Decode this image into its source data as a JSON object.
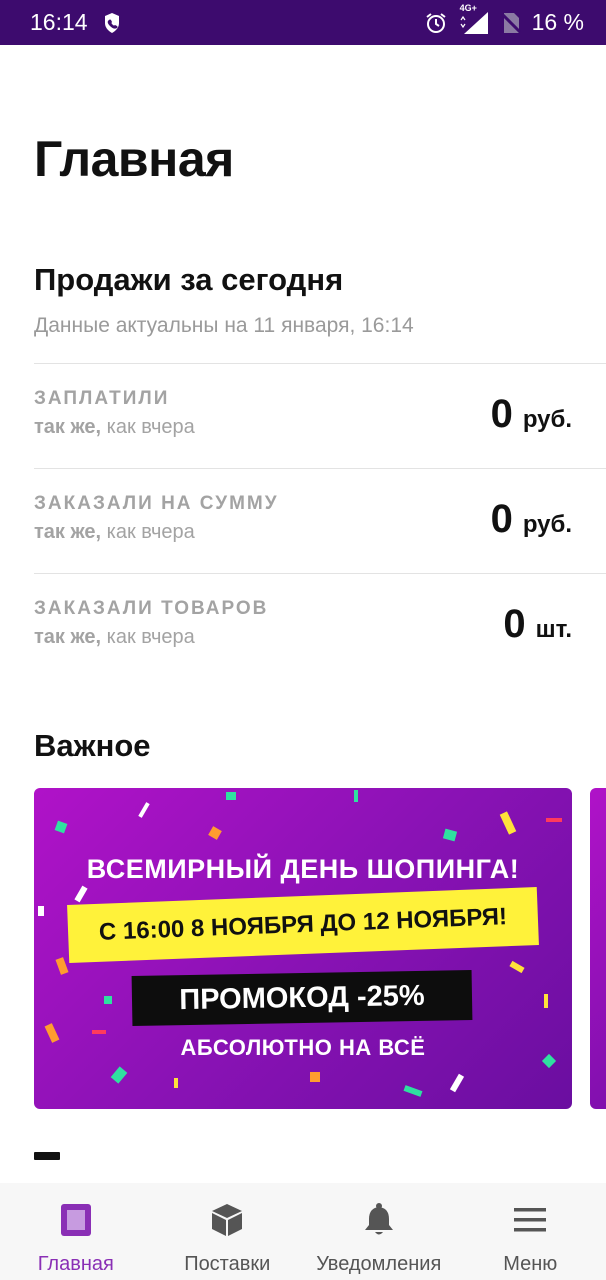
{
  "status_bar": {
    "time": "16:14",
    "network": "4G+",
    "battery": "16 %",
    "icons": [
      "phone-icon",
      "alarm-icon",
      "signal-icon",
      "no-sim-icon"
    ]
  },
  "page_title": "Главная",
  "sales": {
    "title": "Продажи за сегодня",
    "updated": "Данные актуальны на 11 января, 16:14",
    "rows": [
      {
        "label": "ЗАПЛАТИЛИ",
        "compare_bold": "так же,",
        "compare_rest": " как вчера",
        "value": "0",
        "unit": "руб."
      },
      {
        "label": "ЗАКАЗАЛИ НА СУММУ",
        "compare_bold": "так же,",
        "compare_rest": " как вчера",
        "value": "0",
        "unit": "руб."
      },
      {
        "label": "ЗАКАЗАЛИ ТОВАРОВ",
        "compare_bold": "так же,",
        "compare_rest": " как вчера",
        "value": "0",
        "unit": "шт."
      }
    ]
  },
  "important": {
    "title": "Важное",
    "banner": {
      "headline": "ВСЕМИРНЫЙ ДЕНЬ ШОПИНГА!",
      "dates": "С 16:00 8 НОЯБРЯ ДО 12 НОЯБРЯ!",
      "promo": "ПРОМОКОД -25%",
      "sub": "АБСОЛЮТНО НА ВСЁ"
    }
  },
  "colors": {
    "status_bar": "#3d0b6e",
    "accent": "#8a2fb5",
    "banner": "#9b12c0",
    "highlight": "#fff23a"
  },
  "nav": [
    {
      "label": "Главная",
      "icon": "home-icon",
      "active": true
    },
    {
      "label": "Поставки",
      "icon": "box-icon",
      "active": false
    },
    {
      "label": "Уведомления",
      "icon": "bell-icon",
      "active": false
    },
    {
      "label": "Меню",
      "icon": "menu-icon",
      "active": false
    }
  ]
}
